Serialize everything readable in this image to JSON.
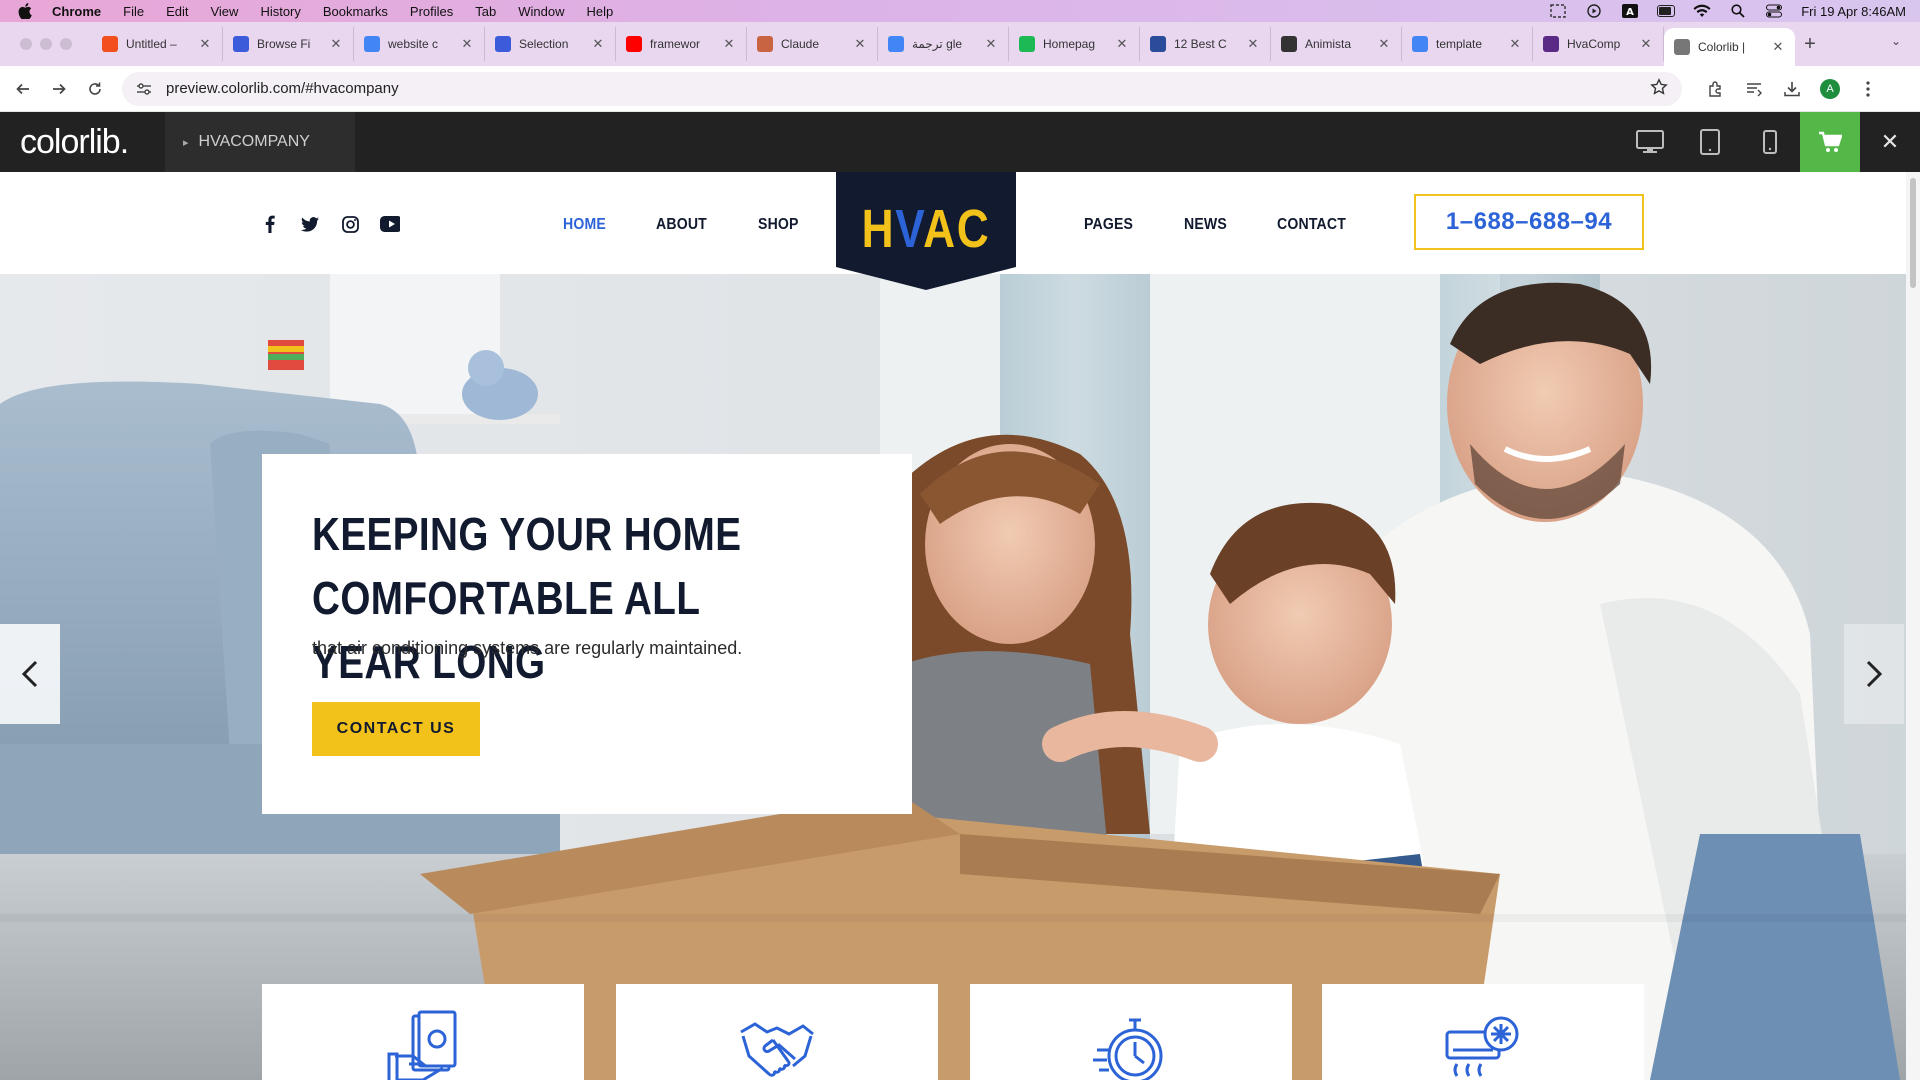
{
  "menubar": {
    "app": "Chrome",
    "items": [
      "File",
      "Edit",
      "View",
      "History",
      "Bookmarks",
      "Profiles",
      "Tab",
      "Window",
      "Help"
    ],
    "clock": "Fri 19 Apr  8:46AM"
  },
  "tabs": [
    {
      "label": "Untitled –",
      "color": "#f24e1e"
    },
    {
      "label": "Browse Fi",
      "color": "#3b5bdb"
    },
    {
      "label": "website c",
      "color": "#4285f4"
    },
    {
      "label": "Selection",
      "color": "#3b5bdb"
    },
    {
      "label": "framewor",
      "color": "#ff0000"
    },
    {
      "label": "Claude",
      "color": "#c96442"
    },
    {
      "label": "ترجمة gle",
      "color": "#4285f4"
    },
    {
      "label": "Homepag",
      "color": "#1db954"
    },
    {
      "label": "12 Best C",
      "color": "#2b4c9a"
    },
    {
      "label": "Animista",
      "color": "#333333"
    },
    {
      "label": "template",
      "color": "#4285f4"
    },
    {
      "label": "HvaComp",
      "color": "#5b2a86"
    },
    {
      "label": "Colorlib |",
      "color": "#777777",
      "active": true
    }
  ],
  "address": {
    "url": "preview.colorlib.com/#hvacompany",
    "profile_initial": "A"
  },
  "preview_bar": {
    "logo": "colorlib.",
    "theme": "HVACOMPANY",
    "accent": "#54b848"
  },
  "site": {
    "nav_left": [
      "HOME",
      "ABOUT",
      "SHOP"
    ],
    "nav_right": [
      "PAGES",
      "NEWS",
      "CONTACT"
    ],
    "logo": {
      "a": "H",
      "b": "V",
      "c": "AC"
    },
    "phone": "1–688–688–94",
    "colors": {
      "navy": "#111a2e",
      "yellow": "#f2c21b",
      "blue": "#2c63d6"
    }
  },
  "hero": {
    "title": "KEEPING YOUR HOME COMFORTABLE ALL YEAR LONG",
    "subtitle": "that air conditioning systems are regularly maintained.",
    "cta": "CONTACT US"
  },
  "features": [
    "money-icon",
    "handshake-icon",
    "stopwatch-icon",
    "air-conditioner-icon"
  ]
}
